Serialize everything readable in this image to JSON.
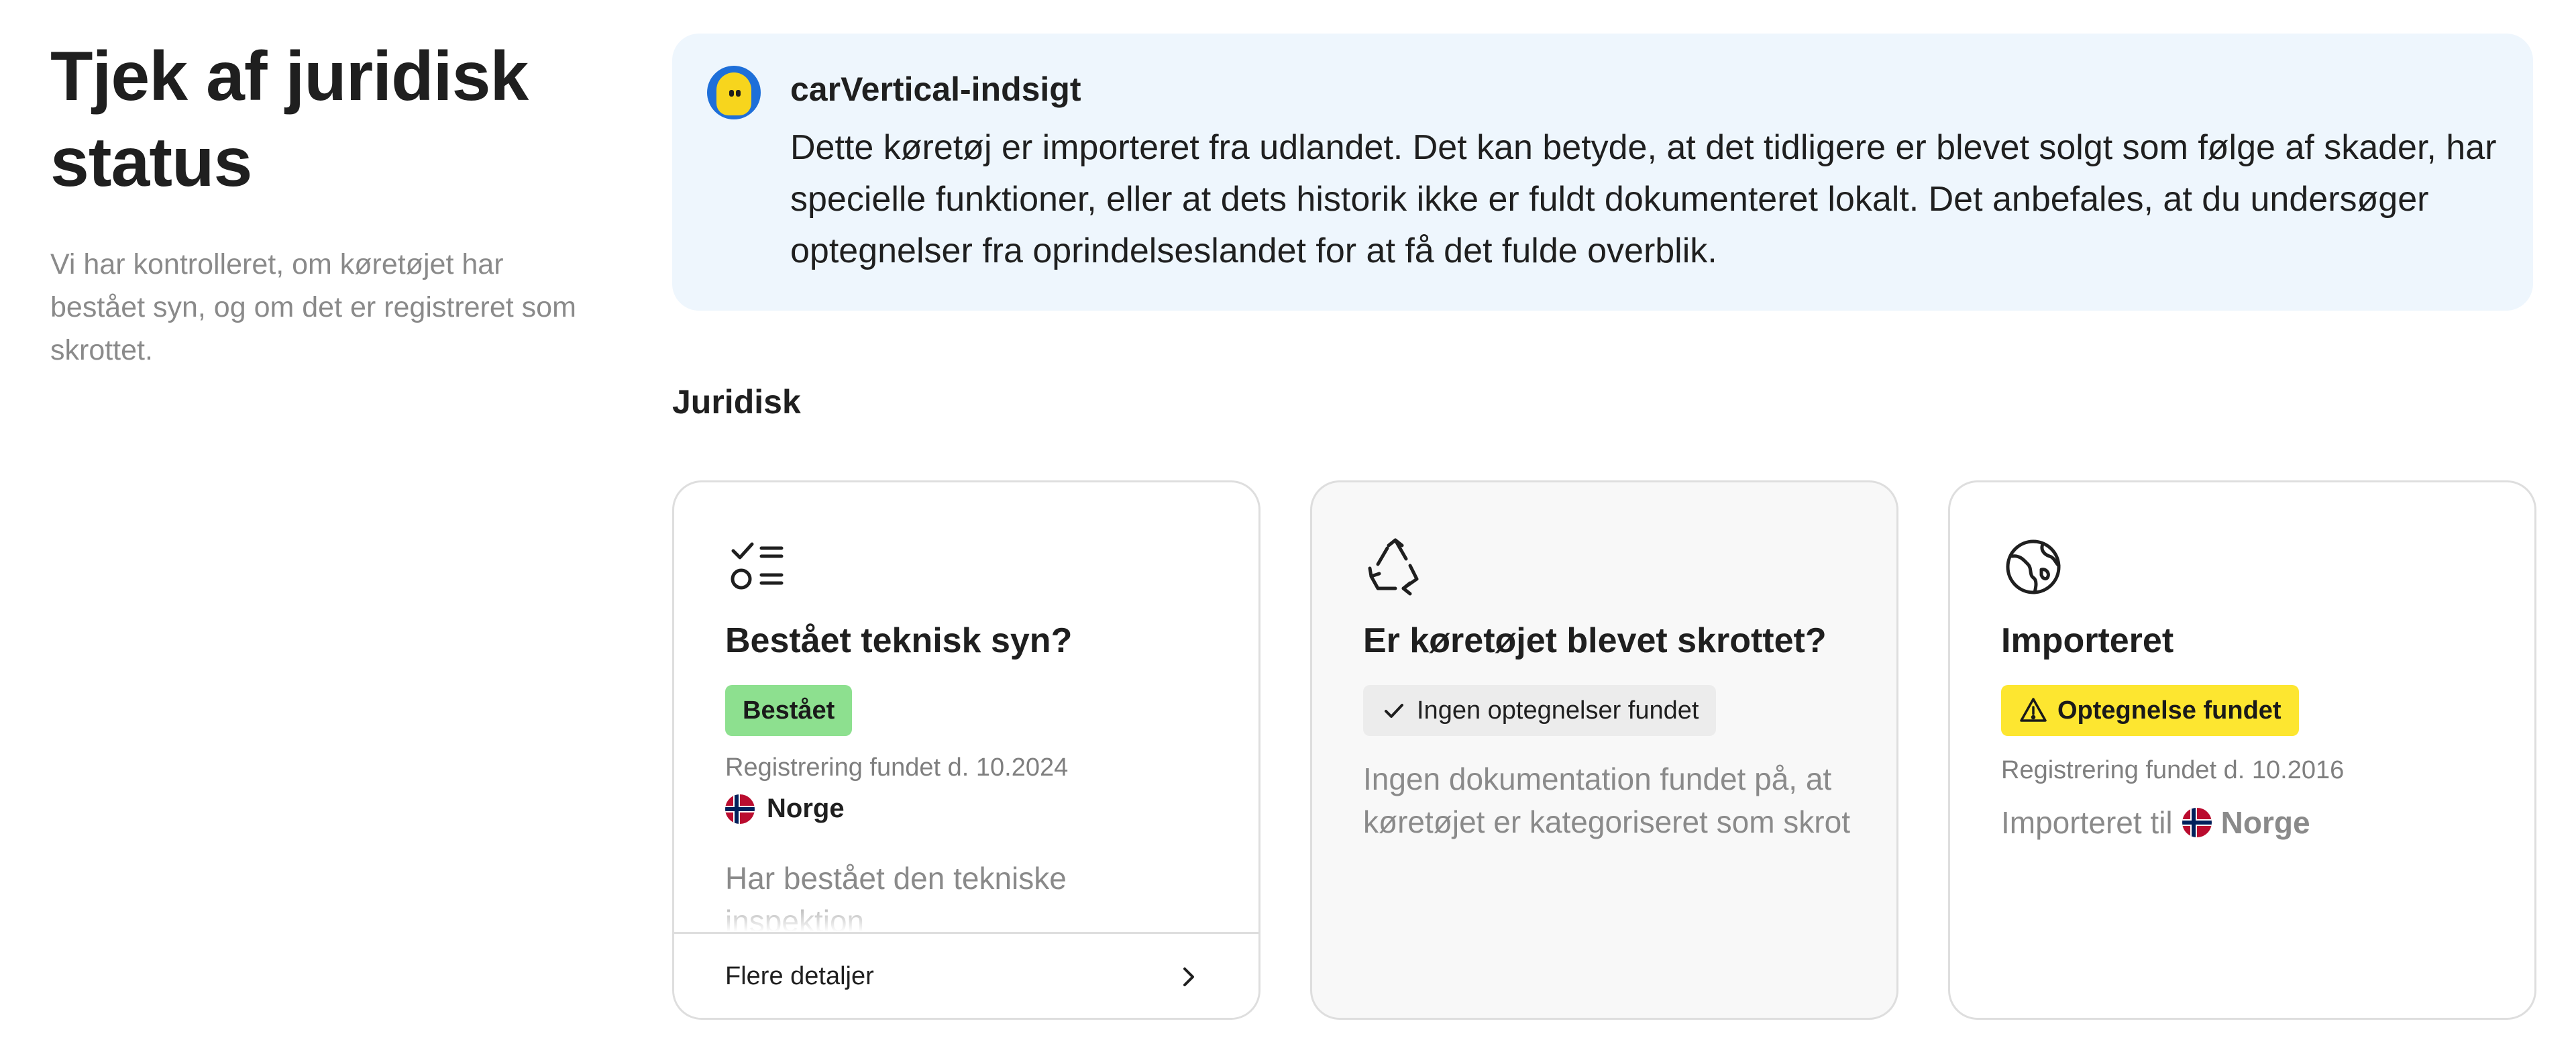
{
  "page": {
    "title": "Tjek af juridisk status",
    "description": "Vi har kontrolleret, om køretøjet har bestået syn, og om det er registreret som skrottet."
  },
  "insight": {
    "title": "carVertical-indsigt",
    "body": "Dette køretøj er importeret fra udlandet. Det kan betyde, at det tidligere er blevet solgt som følge af skader, har specielle funktioner, eller at dets historik ikke er fuldt dokumenteret lokalt. Det anbefales, at du undersøger optegnelser fra oprindelseslandet for at få det fulde overblik."
  },
  "section": {
    "heading": "Juridisk"
  },
  "cards": [
    {
      "icon": "checklist-icon",
      "title": "Bestået teknisk syn?",
      "badge": "Bestået",
      "badge_color": "#8de08f",
      "registration": "Registrering fundet d. 10.2024",
      "country": "Norge",
      "note": "Har bestået den tekniske inspektion",
      "footer": "Flere detaljer"
    },
    {
      "icon": "recycle-icon",
      "title": "Er køretøjet blevet skrottet?",
      "badge": "Ingen optegnelser fundet",
      "badge_color": "#ececec",
      "note": "Ingen dokumentation fundet på, at køretøjet er kategoriseret som skrot"
    },
    {
      "icon": "globe-icon",
      "title": "Importeret",
      "badge": "Optegnelse fundet",
      "badge_color": "#fde630",
      "registration": "Registrering fundet d. 10.2016",
      "imported_prefix": "Importeret til",
      "country": "Norge"
    }
  ]
}
